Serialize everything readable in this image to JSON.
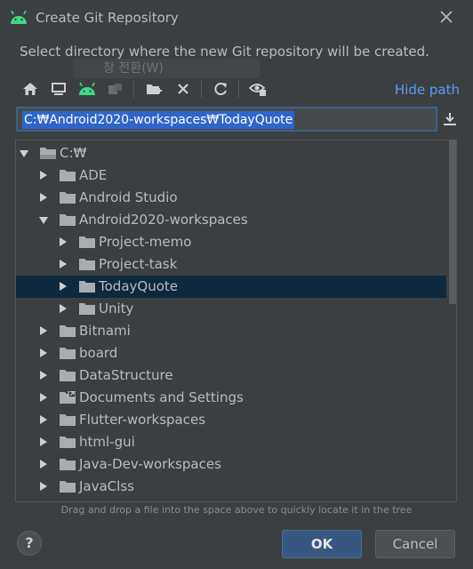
{
  "window": {
    "title": "Create Git Repository",
    "icon": "android-icon"
  },
  "description": "Select directory where the new Git repository will be created.",
  "ghost_text": "창 전환(W)",
  "toolbar": {
    "buttons": [
      "home-icon",
      "desktop-icon",
      "android-icon",
      "module-icon",
      "new-folder-icon",
      "delete-icon",
      "refresh-icon",
      "show-hidden-icon"
    ],
    "hide_path": "Hide path"
  },
  "path": {
    "value": "C:₩Android2020-workspaces₩TodayQuote"
  },
  "tree": {
    "rows": [
      {
        "label": "C:₩",
        "level": 0,
        "state": "expanded",
        "kind": "drive"
      },
      {
        "label": "ADE",
        "level": 1,
        "state": "collapsed",
        "kind": "folder"
      },
      {
        "label": "Android Studio",
        "level": 1,
        "state": "collapsed",
        "kind": "folder"
      },
      {
        "label": "Android2020-workspaces",
        "level": 1,
        "state": "expanded",
        "kind": "folder"
      },
      {
        "label": "Project-memo",
        "level": 2,
        "state": "collapsed",
        "kind": "folder"
      },
      {
        "label": "Project-task",
        "level": 2,
        "state": "collapsed",
        "kind": "folder"
      },
      {
        "label": "TodayQuote",
        "level": 2,
        "state": "collapsed",
        "kind": "folder",
        "selected": true
      },
      {
        "label": "Unity",
        "level": 2,
        "state": "collapsed",
        "kind": "folder"
      },
      {
        "label": "Bitnami",
        "level": 1,
        "state": "collapsed",
        "kind": "folder"
      },
      {
        "label": "board",
        "level": 1,
        "state": "collapsed",
        "kind": "folder"
      },
      {
        "label": "DataStructure",
        "level": 1,
        "state": "collapsed",
        "kind": "folder"
      },
      {
        "label": "Documents and Settings",
        "level": 1,
        "state": "collapsed",
        "kind": "link-folder"
      },
      {
        "label": "Flutter-workspaces",
        "level": 1,
        "state": "collapsed",
        "kind": "folder"
      },
      {
        "label": "html-gui",
        "level": 1,
        "state": "collapsed",
        "kind": "folder"
      },
      {
        "label": "Java-Dev-workspaces",
        "level": 1,
        "state": "collapsed",
        "kind": "folder"
      },
      {
        "label": "JavaClss",
        "level": 1,
        "state": "collapsed",
        "kind": "folder"
      }
    ]
  },
  "hint": "Drag and drop a file into the space above to quickly locate it in the tree",
  "buttons": {
    "help": "?",
    "ok": "OK",
    "cancel": "Cancel"
  },
  "colors": {
    "background": "#3c3f41",
    "selection": "#0d293e",
    "accent": "#589df6",
    "ok_button": "#365880",
    "android_green": "#3ddc84"
  }
}
